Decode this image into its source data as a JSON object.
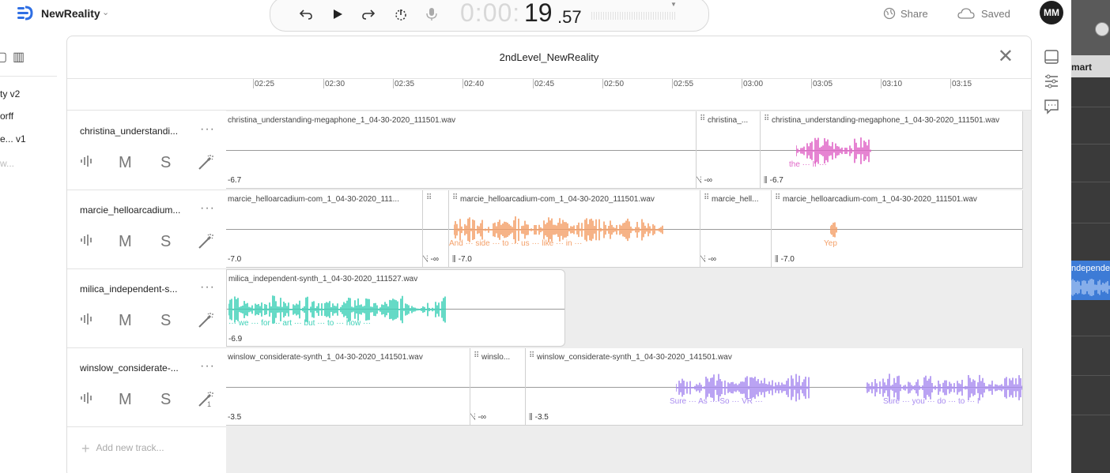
{
  "app": {
    "title": "NewReality"
  },
  "transport": {
    "time_faded": "0:00:",
    "time_main": "19",
    "time_frac": ".57"
  },
  "header": {
    "share_label": "Share",
    "saved_label": "Saved",
    "avatar_initials": "MM"
  },
  "sidebar": {
    "items": [
      {
        "label": "ty v2"
      },
      {
        "label": "orff"
      },
      {
        "label": "e... v1"
      },
      {
        "label": "w..."
      }
    ]
  },
  "far_right": {
    "label": "mart",
    "clip_label": "ndependen"
  },
  "panel": {
    "title": "2ndLevel_NewReality",
    "ruler_ticks": [
      "02:25",
      "02:30",
      "02:35",
      "02:40",
      "02:45",
      "02:50",
      "02:55",
      "03:00",
      "03:05",
      "03:10",
      "03:15"
    ],
    "add_track_label": "Add new track...",
    "tracks": [
      {
        "name": "christina_understandi...",
        "color": "#e066c7",
        "controls": {
          "mute": "M",
          "solo": "S"
        },
        "clips": [
          {
            "name": "christina_understanding-megaphone_1_04-30-2020_111501.wav",
            "gain": "-6.7"
          },
          {
            "name": "christina_...",
            "gain": "-∞"
          },
          {
            "name": "christina_understanding-megaphone_1_04-30-2020_111501.wav",
            "gain": "-6.7",
            "words": "the      ···     If     ···"
          }
        ]
      },
      {
        "name": "marcie_helloarcadium...",
        "color": "#f4a069",
        "controls": {
          "mute": "M",
          "solo": "S"
        },
        "clips": [
          {
            "name": "marcie_helloarcadium-com_1_04-30-2020_111...",
            "gain": "-7.0"
          },
          {
            "name": "",
            "gain": "-∞"
          },
          {
            "name": "marcie_helloarcadium-com_1_04-30-2020_111501.wav",
            "gain": "-7.0",
            "words": "And   ···  side   ···  to   ···  us   ···  like   ···  in   ···"
          },
          {
            "name": "marcie_hell...",
            "gain": "-∞"
          },
          {
            "name": "marcie_helloarcadium-com_1_04-30-2020_111501.wav",
            "gain": "-7.0",
            "words": "Yep"
          }
        ]
      },
      {
        "name": "milica_independent-s...",
        "color": "#3fd1b8",
        "controls": {
          "mute": "M",
          "solo": "S"
        },
        "clips": [
          {
            "name": "milica_independent-synth_1_04-30-2020_111527.wav",
            "gain": "-6.9",
            "words": "···    we    ···  for    ···  art  ···  but  ···  to    ···  how   ···"
          }
        ]
      },
      {
        "name": "winslow_considerate-...",
        "color": "#a98cf0",
        "controls": {
          "mute": "M",
          "solo": "S",
          "fx_badge": "1"
        },
        "clips": [
          {
            "name": "winslow_considerate-synth_1_04-30-2020_141501.wav",
            "gain": "-3.5"
          },
          {
            "name": "winslo...",
            "gain": "-∞"
          },
          {
            "name": "winslow_considerate-synth_1_04-30-2020_141501.wav",
            "gain": "-3.5",
            "words": "Sure   ···  As   ···  So   ···  VR   ···",
            "words2": "Sure   ···   you  ···  do  ···  to   ···  I"
          }
        ]
      }
    ]
  }
}
